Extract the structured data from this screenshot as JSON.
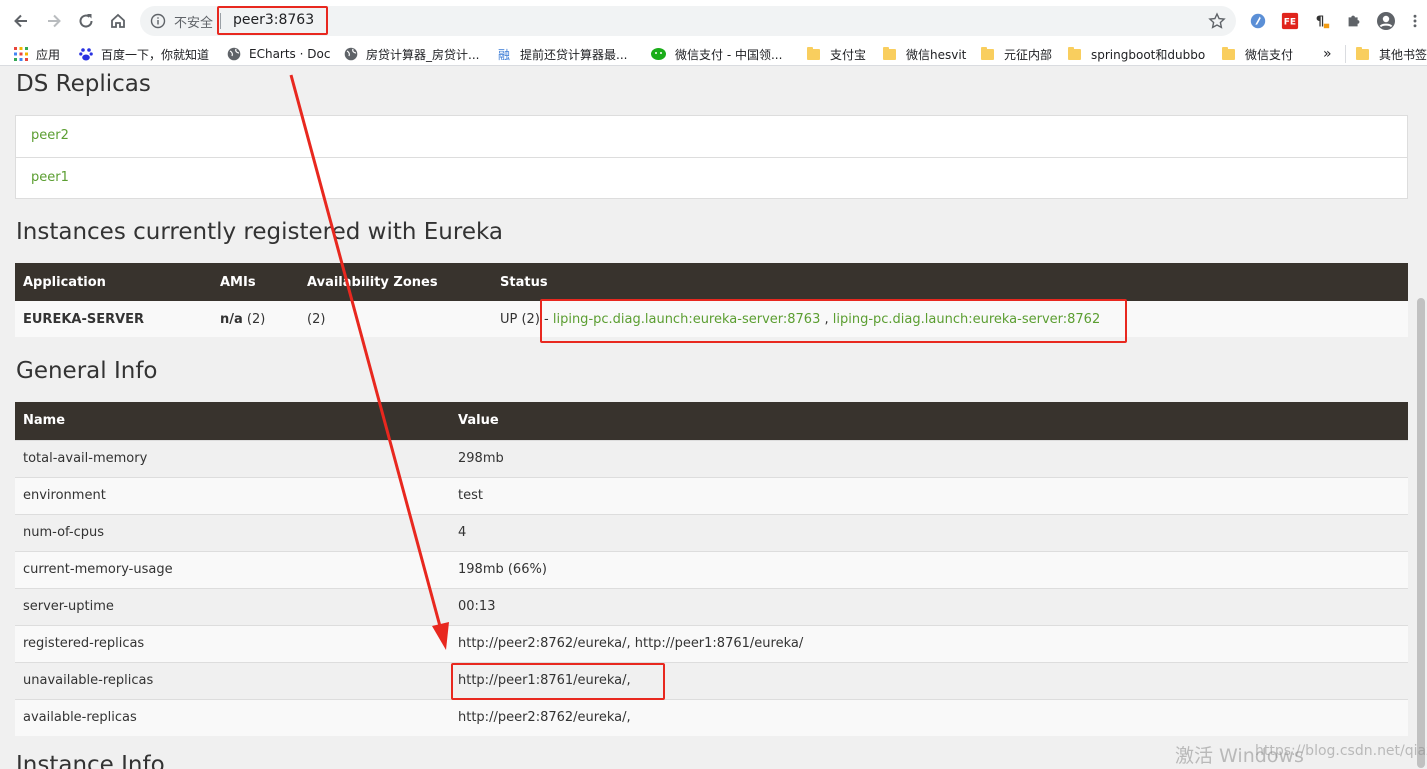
{
  "browser": {
    "insecure_label": "不安全",
    "url": "peer3:8763",
    "bookmarks": [
      "应用",
      "百度一下，你就知道",
      "ECharts · Doc",
      "房贷计算器_房贷计...",
      "提前还贷计算器最...",
      "微信支付 - 中国领...",
      "支付宝",
      "微信hesvit",
      "元征内部",
      "springboot和dubbo",
      "微信支付",
      "»",
      "其他书签"
    ]
  },
  "ds_replicas": {
    "title": "DS Replicas",
    "items": [
      "peer2",
      "peer1"
    ]
  },
  "instances": {
    "title": "Instances currently registered with Eureka",
    "headers": [
      "Application",
      "AMIs",
      "Availability Zones",
      "Status"
    ],
    "row": {
      "application": "EUREKA-SERVER",
      "amis_bold": "n/a",
      "amis_count": " (2)",
      "zones": "(2)",
      "status_prefix": "UP (2) - ",
      "instance1": "liping-pc.diag.launch:eureka-server:8763",
      "separator": " , ",
      "instance2": "liping-pc.diag.launch:eureka-server:8762"
    }
  },
  "general_info": {
    "title": "General Info",
    "headers": [
      "Name",
      "Value"
    ],
    "rows": [
      {
        "name": "total-avail-memory",
        "value": "298mb"
      },
      {
        "name": "environment",
        "value": "test"
      },
      {
        "name": "num-of-cpus",
        "value": "4"
      },
      {
        "name": "current-memory-usage",
        "value": "198mb (66%)"
      },
      {
        "name": "server-uptime",
        "value": "00:13"
      },
      {
        "name": "registered-replicas",
        "value": "http://peer2:8762/eureka/, http://peer1:8761/eureka/"
      },
      {
        "name": "unavailable-replicas",
        "value": "http://peer1:8761/eureka/,"
      },
      {
        "name": "available-replicas",
        "value": "http://peer2:8762/eureka/,"
      }
    ]
  },
  "instance_info": {
    "title": "Instance Info"
  },
  "watermark": {
    "text": "激活 Windows",
    "overlay": "https://blog.csdn.net/qiazliping"
  },
  "colors": {
    "annotation": "#e8281f",
    "link": "#5b9e31",
    "table_header": "#38332d"
  }
}
